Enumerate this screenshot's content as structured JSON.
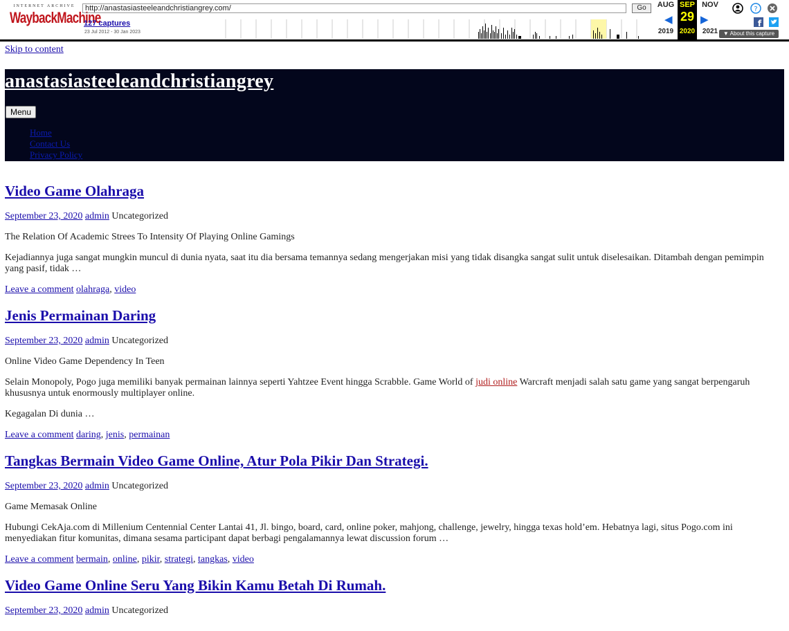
{
  "wayback": {
    "logo_top": "INTERNET ARCHIVE",
    "logo_main": "WaybackMachine",
    "url": "http://anastasiasteeleandchristiangrey.com/",
    "go_label": "Go",
    "captures": "127 captures",
    "range": "23 Jul 2012 - 30 Jan 2023",
    "months": {
      "prev": "AUG",
      "cur": "SEP",
      "next": "NOV"
    },
    "day": "29",
    "years": {
      "prev": "2019",
      "cur": "2020",
      "next": "2021"
    },
    "about": "About this capture",
    "icons": [
      "user-icon",
      "help-icon",
      "close-icon",
      "facebook-icon",
      "twitter-icon"
    ]
  },
  "skip_link": "Skip to content",
  "site": {
    "title": "anastasiasteeleandchristiangrey",
    "menu_label": "Menu",
    "nav": [
      "Home",
      "Contact Us",
      "Privacy Policy"
    ]
  },
  "posts": [
    {
      "title": "Video Game Olahraga",
      "date": "September 23, 2020",
      "author": "admin",
      "category": "Uncategorized",
      "subtitle": "The Relation Of Academic Strees To Intensity Of Playing Online Gamings",
      "excerpt": "Kejadiannya juga sangat mungkin muncul di dunia nyata, saat itu dia bersama temannya sedang mengerjakan misi yang tidak disangka sangat sulit untuk diselesaikan. Ditambah dengan pemimpin yang pasif, tidak …",
      "comment": "Leave a comment",
      "tags": [
        "olahraga",
        "video"
      ]
    },
    {
      "title": "Jenis Permainan Daring",
      "date": "September 23, 2020",
      "author": "admin",
      "category": "Uncategorized",
      "subtitle": "Online Video Game Dependency In Teen",
      "excerpt_before": "Selain Monopoly, Pogo juga memiliki banyak permainan lainnya seperti Yahtzee Event hingga Scrabble. Game World of ",
      "excerpt_link": "judi online",
      "excerpt_after": " Warcraft menjadi salah satu game yang sangat berpengaruh khususnya untuk enormously multiplayer online.",
      "extra": "Kegagalan Di dunia …",
      "comment": "Leave a comment",
      "tags": [
        "daring",
        "jenis",
        "permainan"
      ]
    },
    {
      "title": "Tangkas Bermain Video Game Online, Atur Pola Pikir Dan Strategi.",
      "date": "September 23, 2020",
      "author": "admin",
      "category": "Uncategorized",
      "subtitle": "Game Memasak Online",
      "excerpt": "Hubungi CekAja.com di Millenium Centennial Center Lantai 41, Jl. bingo, board, card, online poker, mahjong, challenge, jewelry, hingga texas hold’em. Hebatnya lagi, situs Pogo.com ini menyediakan fitur komunitas, dimana sesama participant dapat berbagi pengalamannya lewat discussion forum …",
      "comment": "Leave a comment",
      "tags": [
        "bermain",
        "online",
        "pikir",
        "strategi",
        "tangkas",
        "video"
      ]
    },
    {
      "title": "Video Game Online Seru Yang Bikin Kamu Betah Di Rumah.",
      "date": "September 23, 2020",
      "author": "admin",
      "category": "Uncategorized"
    }
  ],
  "sep": ", "
}
